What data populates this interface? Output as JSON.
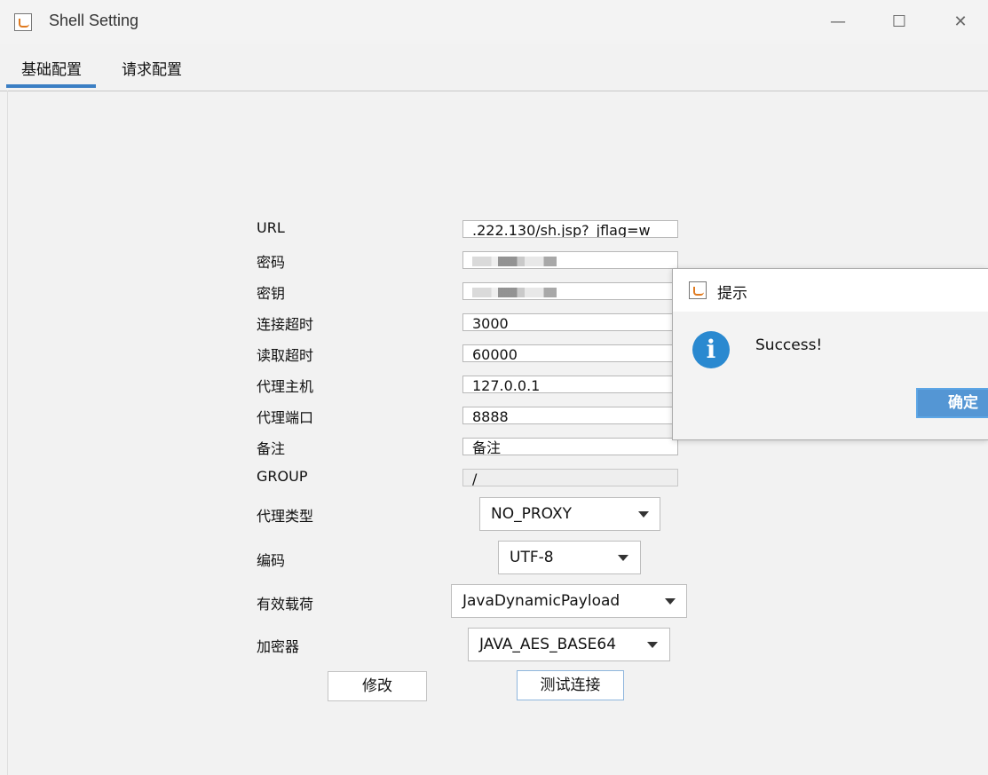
{
  "window": {
    "title": "Shell Setting",
    "minimize": "—",
    "maximize": "☐",
    "close": "✕"
  },
  "tabs": [
    {
      "label": "基础配置"
    },
    {
      "label": "请求配置"
    }
  ],
  "form": {
    "url_label": "URL",
    "url_value": ".222.130/sh.jsp?_jflag=w",
    "password_label": "密码",
    "key_label": "密钥",
    "connect_timeout_label": "连接超时",
    "connect_timeout_value": "3000",
    "read_timeout_label": "读取超时",
    "read_timeout_value": "60000",
    "proxy_host_label": "代理主机",
    "proxy_host_value": "127.0.0.1",
    "proxy_port_label": "代理端口",
    "proxy_port_value": "8888",
    "remark_label": "备注",
    "remark_value": "备注",
    "group_label": "GROUP",
    "group_value": "/",
    "proxy_type_label": "代理类型",
    "proxy_type_value": "NO_PROXY",
    "encoding_label": "编码",
    "encoding_value": "UTF-8",
    "payload_label": "有效载荷",
    "payload_value": "JavaDynamicPayload",
    "cryptor_label": "加密器",
    "cryptor_value": "JAVA_AES_BASE64"
  },
  "buttons": {
    "modify": "修改",
    "test_connection": "测试连接"
  },
  "dialog": {
    "title": "提示",
    "message": "Success!",
    "ok": "确定"
  },
  "colors": {
    "accent": "#3b7fc4",
    "info": "#2a89d0",
    "ok_button": "#5496d4"
  },
  "icons": {
    "app": "java-icon",
    "dialog": "java-icon",
    "info": "info-icon",
    "dropdown": "chevron-down-icon"
  }
}
